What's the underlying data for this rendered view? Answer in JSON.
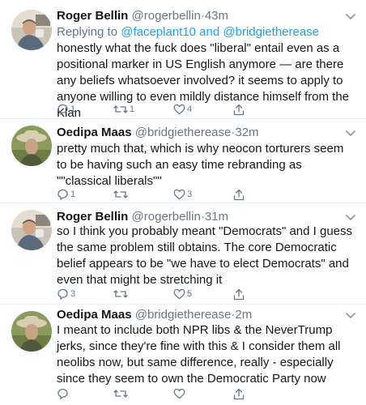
{
  "tweets": [
    {
      "name": "Roger Bellin",
      "handle": "@rogerbellin",
      "separator": "·",
      "time": "43m",
      "replying_prefix": "Replying to ",
      "replying_to_1": "@faceplant10",
      "replying_and": " and ",
      "replying_to_2": "@bridgietherease",
      "text": "honestly what the fuck does \"liberal\" entail even as a positional marker in US English anymore — are there any beliefs whatsoever involved? it seems to apply to anyone willing to even mildly distance himself from the Klan",
      "replies": "1",
      "retweets": "1",
      "likes": "4"
    },
    {
      "name": "Oedipa Maas",
      "handle": "@bridgietherease",
      "separator": "·",
      "time": "32m",
      "text": "pretty much that, which is why neocon torturers seem to be having such an easy time rebranding as \"\"classical liberals\"\"",
      "replies": "1",
      "retweets": "",
      "likes": "3"
    },
    {
      "name": "Roger Bellin",
      "handle": "@rogerbellin",
      "separator": "·",
      "time": "31m",
      "text": "so I think you probably meant \"Democrats\" and I guess the same problem still obtains. The core Democratic belief appears to be \"we have to elect Democrats\" and even that might be stretching it",
      "replies": "3",
      "retweets": "",
      "likes": "5"
    },
    {
      "name": "Oedipa Maas",
      "handle": "@bridgietherease",
      "separator": "·",
      "time": "2m",
      "text": "I meant to include both NPR libs & the NeverTrump jerks, since they're fine with this & I consider them all neolibs now, but same difference, really - especially since they seem to own the Democratic Party now",
      "replies": "",
      "retweets": "",
      "likes": ""
    }
  ],
  "icons": {
    "reply": "reply-icon",
    "retweet": "retweet-icon",
    "like": "heart-icon",
    "share": "share-icon",
    "caret": "chevron-down-icon"
  },
  "colors": {
    "text": "#14171a",
    "muted": "#657786",
    "link": "#1da1f2",
    "border": "#e6ecf0"
  }
}
